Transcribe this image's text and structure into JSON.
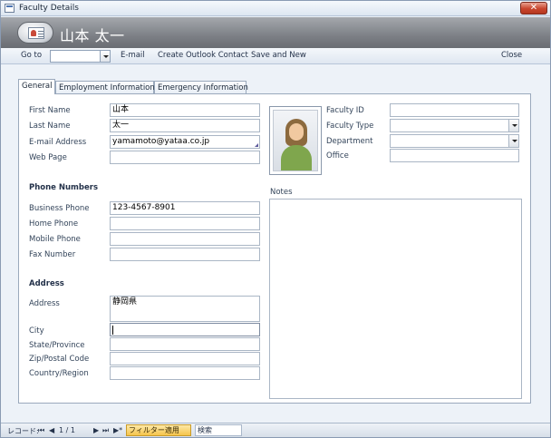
{
  "window": {
    "title": "Faculty Details",
    "close_glyph": "✕"
  },
  "header": {
    "name": "山本 太一"
  },
  "toolbar": {
    "goto_label": "Go to",
    "goto_value": "",
    "email": "E-mail",
    "outlook": "Create Outlook Contact",
    "save_new": "Save and New",
    "close": "Close"
  },
  "tabs": [
    "General",
    "Employment Information",
    "Emergency Information"
  ],
  "general": {
    "first_name_label": "First Name",
    "first_name": "山本",
    "last_name_label": "Last Name",
    "last_name": "太一",
    "email_label": "E-mail Address",
    "email": "yamamoto@yataa.co.jp",
    "web_label": "Web Page",
    "web": "",
    "phone_section": "Phone Numbers",
    "business_label": "Business Phone",
    "business": "123-4567-8901",
    "home_label": "Home Phone",
    "home": "",
    "mobile_label": "Mobile Phone",
    "mobile": "",
    "fax_label": "Fax Number",
    "fax": "",
    "address_section": "Address",
    "address_label": "Address",
    "address": "静岡県",
    "city_label": "City",
    "city": "",
    "state_label": "State/Province",
    "state": "",
    "zip_label": "Zip/Postal Code",
    "zip": "",
    "country_label": "Country/Region",
    "country": "",
    "faculty_id_label": "Faculty ID",
    "faculty_id": "",
    "faculty_type_label": "Faculty Type",
    "faculty_type": "",
    "department_label": "Department",
    "department": "",
    "office_label": "Office",
    "office": "",
    "notes_label": "Notes",
    "notes": ""
  },
  "status": {
    "record_label": "レコード:",
    "nav_first": "⏮",
    "nav_prev": "◀",
    "position": "1 / 1",
    "nav_next": "▶",
    "nav_last": "⏭",
    "nav_new": "▶*",
    "filter": "フィルター適用",
    "search": "検索"
  },
  "colors": {
    "header_band": "#7d8086",
    "filter_badge": "#f5c44c",
    "accent": "#4b74b2"
  }
}
